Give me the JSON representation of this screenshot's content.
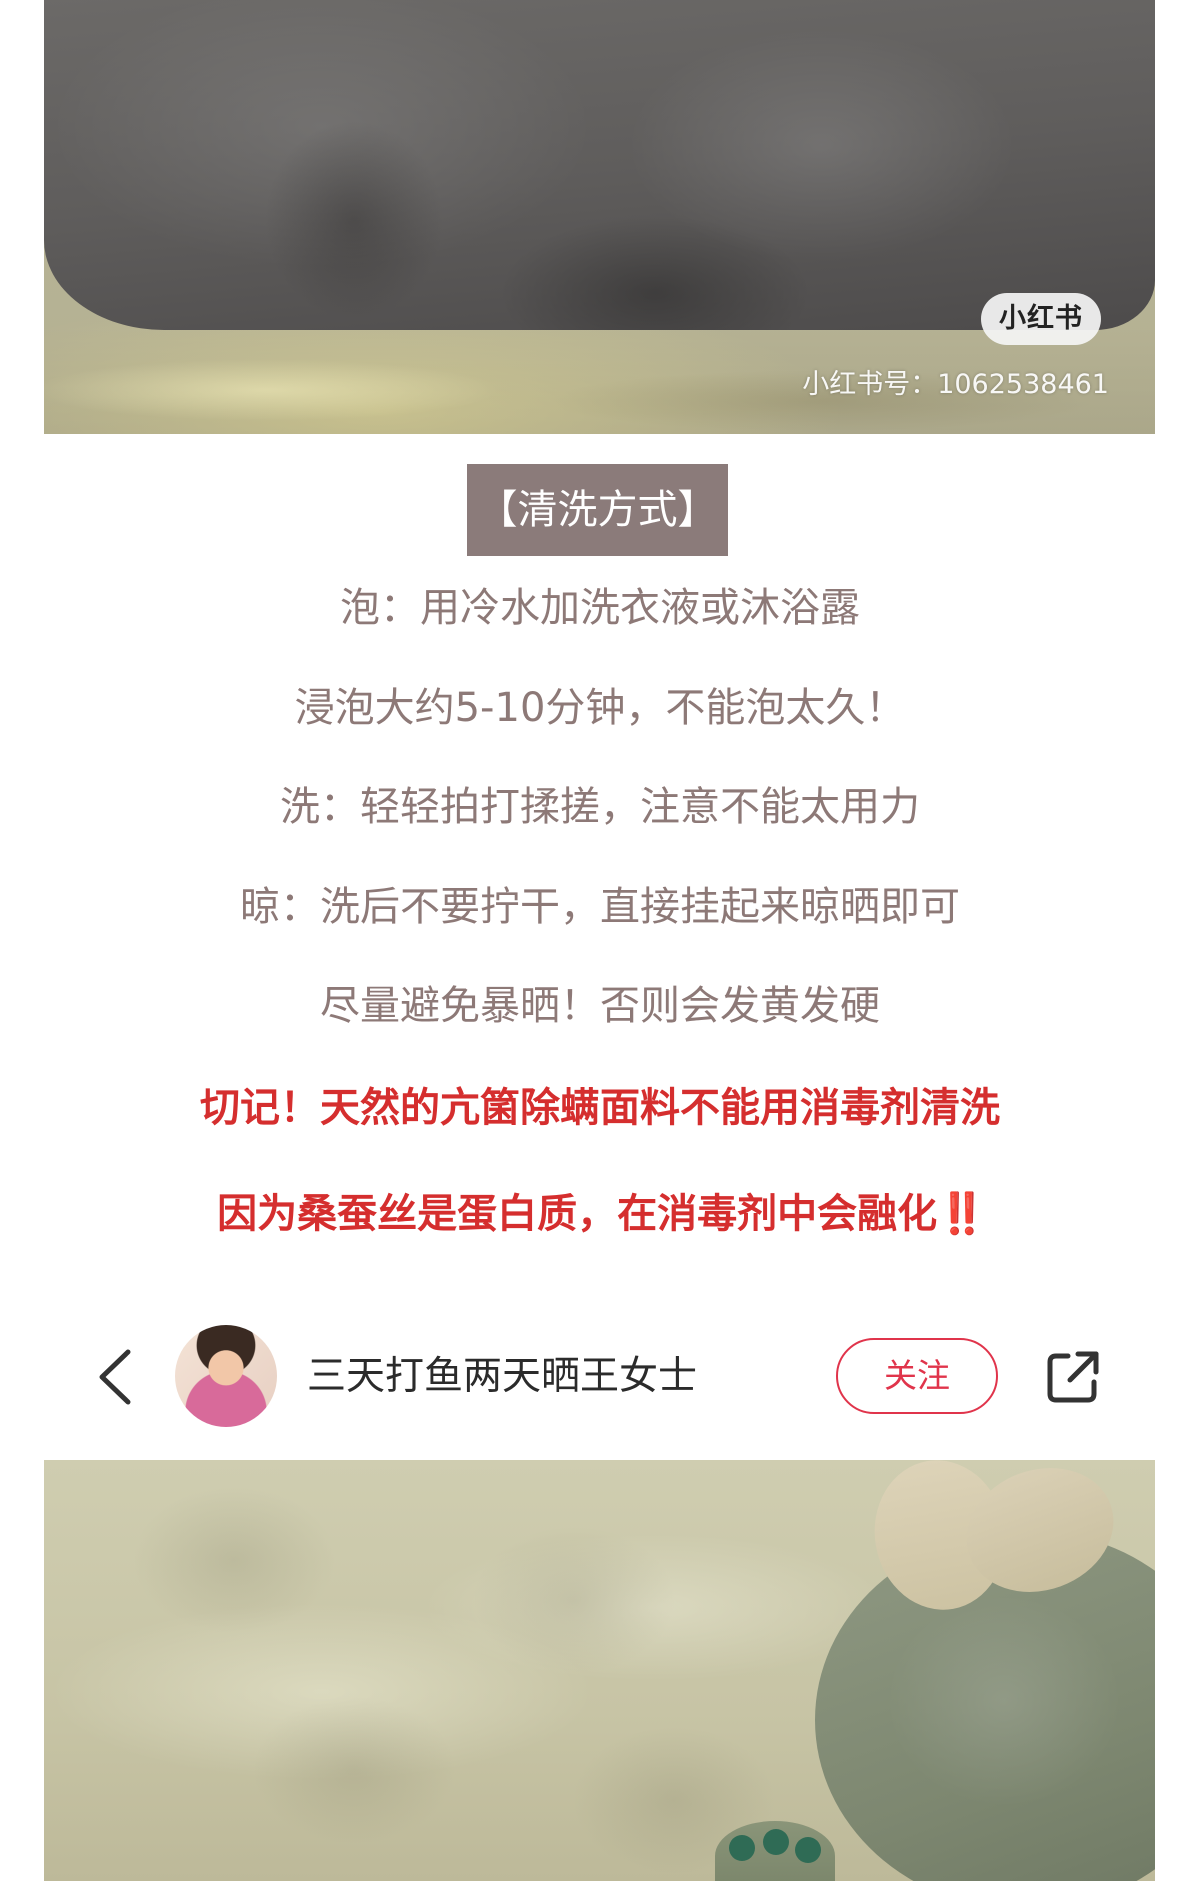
{
  "watermark": {
    "logo_text": "小红书",
    "id_text": "小红书号：1062538461"
  },
  "content": {
    "section_title": "【清洗方式】",
    "lines": [
      "泡：用冷水加洗衣液或沐浴露",
      "浸泡大约5-10分钟，不能泡太久！",
      "洗：轻轻拍打揉搓，注意不能太用力",
      "晾：洗后不要拧干，直接挂起来晾晒即可",
      "尽量避免暴晒！否则会发黄发硬"
    ],
    "warnings": [
      "切记！天然的亢箘除螨面料不能用消毒剂清洗",
      "因为桑蚕丝是蛋白质，在消毒剂中会融化"
    ],
    "warning_emoji": "‼️"
  },
  "header": {
    "back_icon": "chevron-left-icon",
    "username": "三天打鱼两天晒王女士",
    "follow_label": "关注",
    "share_icon": "share-icon"
  },
  "colors": {
    "title_bg": "#8b7b7a",
    "body_text": "#8d7977",
    "warning_text": "#d52e2e",
    "follow_accent": "#e0344b"
  }
}
